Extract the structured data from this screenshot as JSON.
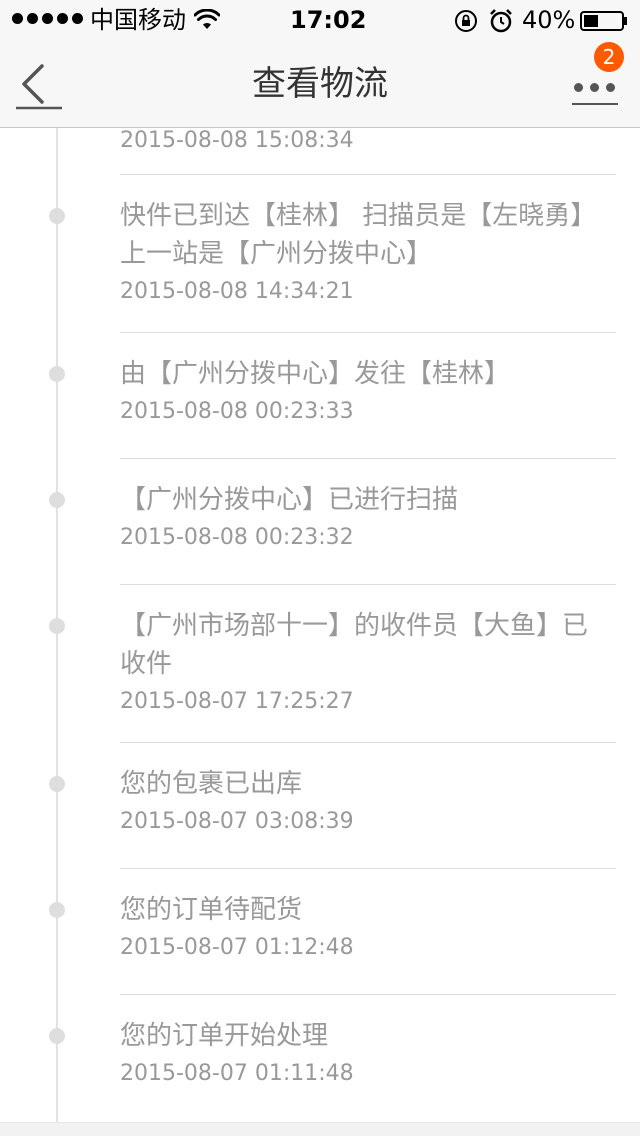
{
  "status_bar": {
    "carrier": "中国移动",
    "time": "17:02",
    "battery": "40%",
    "signal_bars": 5,
    "battery_level": 0.4
  },
  "header": {
    "title": "查看物流",
    "badge_count": "2"
  },
  "timeline": {
    "top_time": "2015-08-08 15:08:34",
    "entries": [
      {
        "message": "快件已到达【桂林】 扫描员是【左晓勇】上一站是【广州分拨中心】",
        "time": "2015-08-08 14:34:21"
      },
      {
        "message": "由【广州分拨中心】发往【桂林】",
        "time": "2015-08-08 00:23:33"
      },
      {
        "message": "【广州分拨中心】已进行扫描",
        "time": "2015-08-08 00:23:32"
      },
      {
        "message": "【广州市场部十一】的收件员【大鱼】已收件",
        "time": "2015-08-07 17:25:27"
      },
      {
        "message": "您的包裹已出库",
        "time": "2015-08-07 03:08:39"
      },
      {
        "message": "您的订单待配货",
        "time": "2015-08-07 01:12:48"
      },
      {
        "message": "您的订单开始处理",
        "time": "2015-08-07 01:11:48"
      }
    ]
  }
}
